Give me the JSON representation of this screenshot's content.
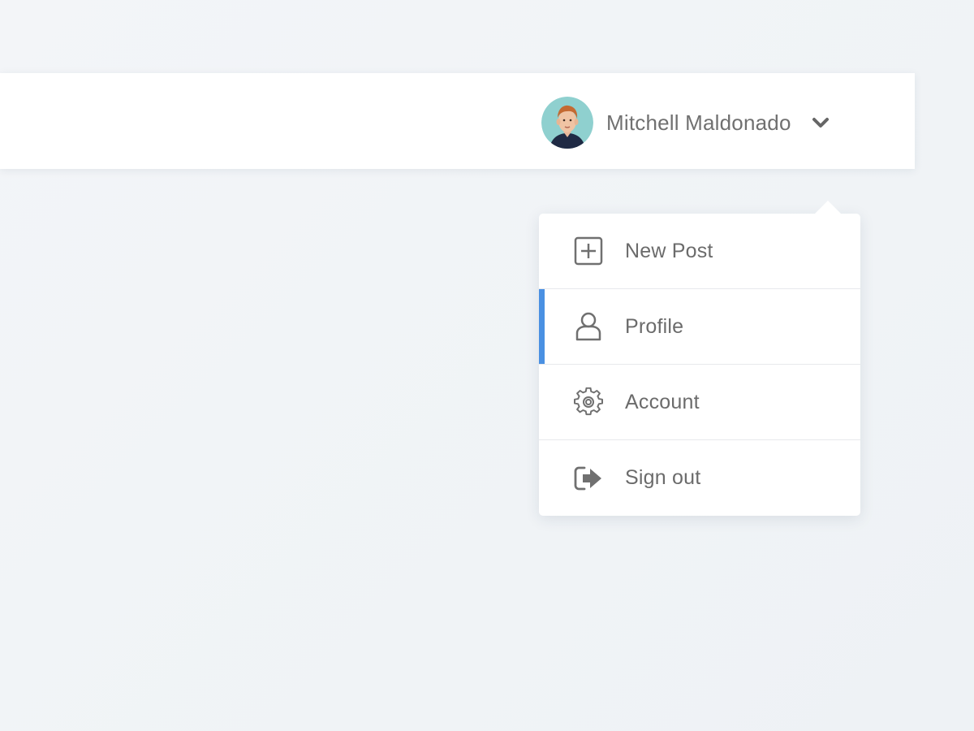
{
  "header": {
    "user": {
      "name": "Mitchell Maldonado",
      "avatar": "user-avatar-photo",
      "chevron_icon": "chevron-down-icon"
    }
  },
  "user_menu": {
    "items": [
      {
        "label": "New Post",
        "icon": "plus-square-icon",
        "active": false
      },
      {
        "label": "Profile",
        "icon": "user-icon",
        "active": true
      },
      {
        "label": "Account",
        "icon": "gear-icon",
        "active": false
      },
      {
        "label": "Sign out",
        "icon": "sign-out-icon",
        "active": false
      }
    ]
  },
  "colors": {
    "accent": "#4a90e2",
    "text": "#6b6b6b",
    "background": "#f1f4f7"
  }
}
